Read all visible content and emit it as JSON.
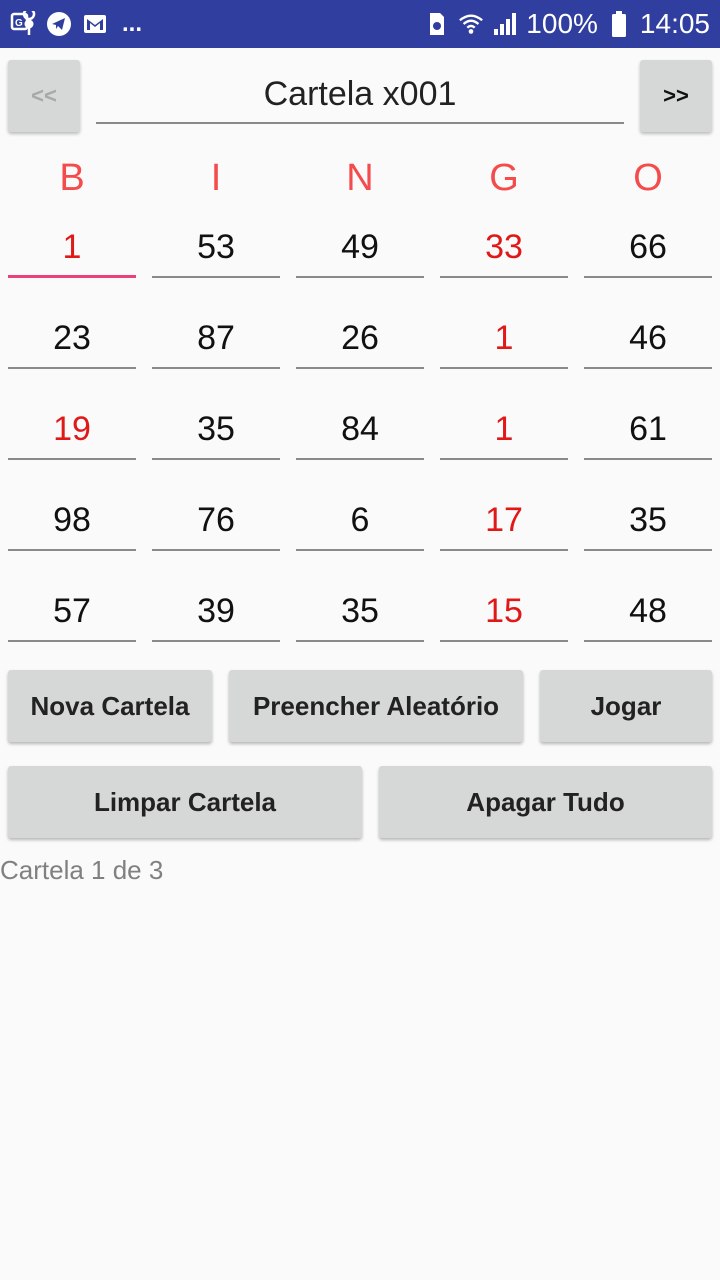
{
  "status_bar": {
    "overflow": "...",
    "battery": "100%",
    "time": "14:05",
    "icons": [
      "maps-location-icon",
      "telegram-icon",
      "gmail-icon",
      "storage-icon",
      "wifi-icon",
      "signal-icon",
      "battery-icon"
    ]
  },
  "header": {
    "prev_label": "<<",
    "next_label": ">>",
    "title": "Cartela x001"
  },
  "letters": [
    "B",
    "I",
    "N",
    "G",
    "O"
  ],
  "grid": [
    [
      "1",
      "53",
      "49",
      "33",
      "66"
    ],
    [
      "23",
      "87",
      "26",
      "1",
      "46"
    ],
    [
      "19",
      "35",
      "84",
      "1",
      "61"
    ],
    [
      "98",
      "76",
      "6",
      "17",
      "35"
    ],
    [
      "57",
      "39",
      "35",
      "15",
      "48"
    ]
  ],
  "highlighted_cells": [
    "0-0",
    "0-3",
    "1-3",
    "2-0",
    "2-3",
    "3-3",
    "4-3"
  ],
  "buttons": {
    "nova_cartela": "Nova Cartela",
    "preencher": "Preencher Aleatório",
    "jogar": "Jogar",
    "limpar": "Limpar Cartela",
    "apagar": "Apagar Tudo"
  },
  "footer": "Cartela 1 de 3",
  "colors": {
    "status_bar": "#303f9f",
    "letter": "#f44c4c",
    "highlight": "#e01818",
    "focus_underline": "#ec407a",
    "button": "#d6d7d7"
  }
}
